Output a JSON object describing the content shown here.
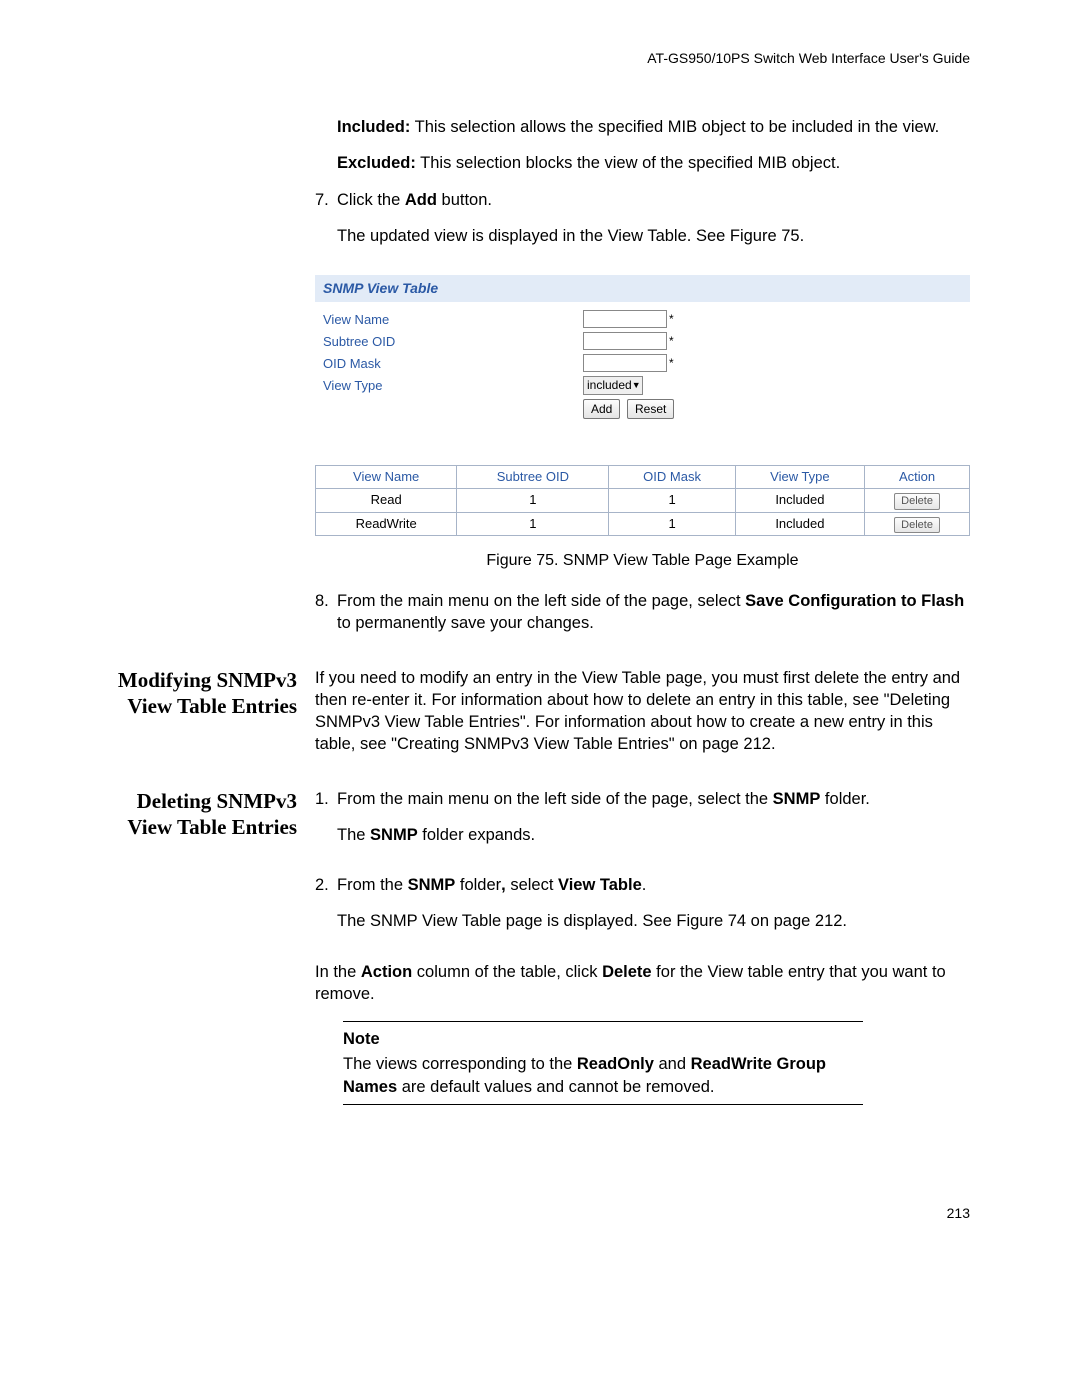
{
  "header": "AT-GS950/10PS Switch Web Interface User's Guide",
  "intro": {
    "included_label": "Included:",
    "included_text": " This selection allows the specified MIB object to be included in the view.",
    "excluded_label": "Excluded:",
    "excluded_text": " This selection blocks the view of the specified MIB object."
  },
  "step7": {
    "num": "7.",
    "line_a": "Click the ",
    "line_b_bold": "Add",
    "line_c": " button.",
    "result": "The updated view is displayed in the View Table. See Figure 75."
  },
  "snmp_form": {
    "title": "SNMP View Table",
    "labels": {
      "view_name": "View Name",
      "subtree_oid": "Subtree OID",
      "oid_mask": "OID Mask",
      "view_type": "View Type"
    },
    "select_value": "included",
    "add_btn": "Add",
    "reset_btn": "Reset"
  },
  "table": {
    "headers": [
      "View Name",
      "Subtree OID",
      "OID Mask",
      "View Type",
      "Action"
    ],
    "rows": [
      [
        "Read",
        "1",
        "1",
        "Included",
        "Delete"
      ],
      [
        "ReadWrite",
        "1",
        "1",
        "Included",
        "Delete"
      ]
    ]
  },
  "fig_caption": "Figure 75. SNMP View Table Page Example",
  "step8": {
    "num": "8.",
    "a": "From the main menu on the left side of the page, select ",
    "b_bold": "Save Configuration to Flash",
    "c": " to permanently save your changes."
  },
  "section_modify": {
    "heading": "Modifying SNMPv3 View Table Entries",
    "body": "If you need to modify an entry in the View Table page, you must first delete the entry and then re-enter it. For information about how to delete an entry in this table, see \"Deleting SNMPv3 View Table Entries\". For information about how to create a new entry in this table, see \"Creating SNMPv3 View Table Entries\" on page 212."
  },
  "section_delete": {
    "heading": "Deleting SNMPv3 View Table Entries",
    "s1": {
      "num": "1.",
      "a": "From the main menu on the left side of the page, select the ",
      "b_bold": "SNMP",
      "c": " folder."
    },
    "s1_result_a": "The ",
    "s1_result_b_bold": "SNMP",
    "s1_result_c": " folder expands.",
    "s2": {
      "num": "2.",
      "a": "From the ",
      "b_bold": "SNMP",
      "c": " folder",
      "d_bold": ",",
      "e": " select ",
      "f_bold": "View Table",
      "g": "."
    },
    "s2_result": "The SNMP View Table page is displayed. See Figure 74 on page 212.",
    "action_a": "In the ",
    "action_b_bold": "Action",
    "action_c": " column of the table, click ",
    "action_d_bold": "Delete",
    "action_e": " for the View table entry that you want to remove.",
    "note_title": "Note",
    "note_a": "The views corresponding to the ",
    "note_b_bold": "ReadOnly",
    "note_c": " and ",
    "note_d_bold": "ReadWrite Group Names",
    "note_e": " are default values and cannot be removed."
  },
  "page_number": "213"
}
